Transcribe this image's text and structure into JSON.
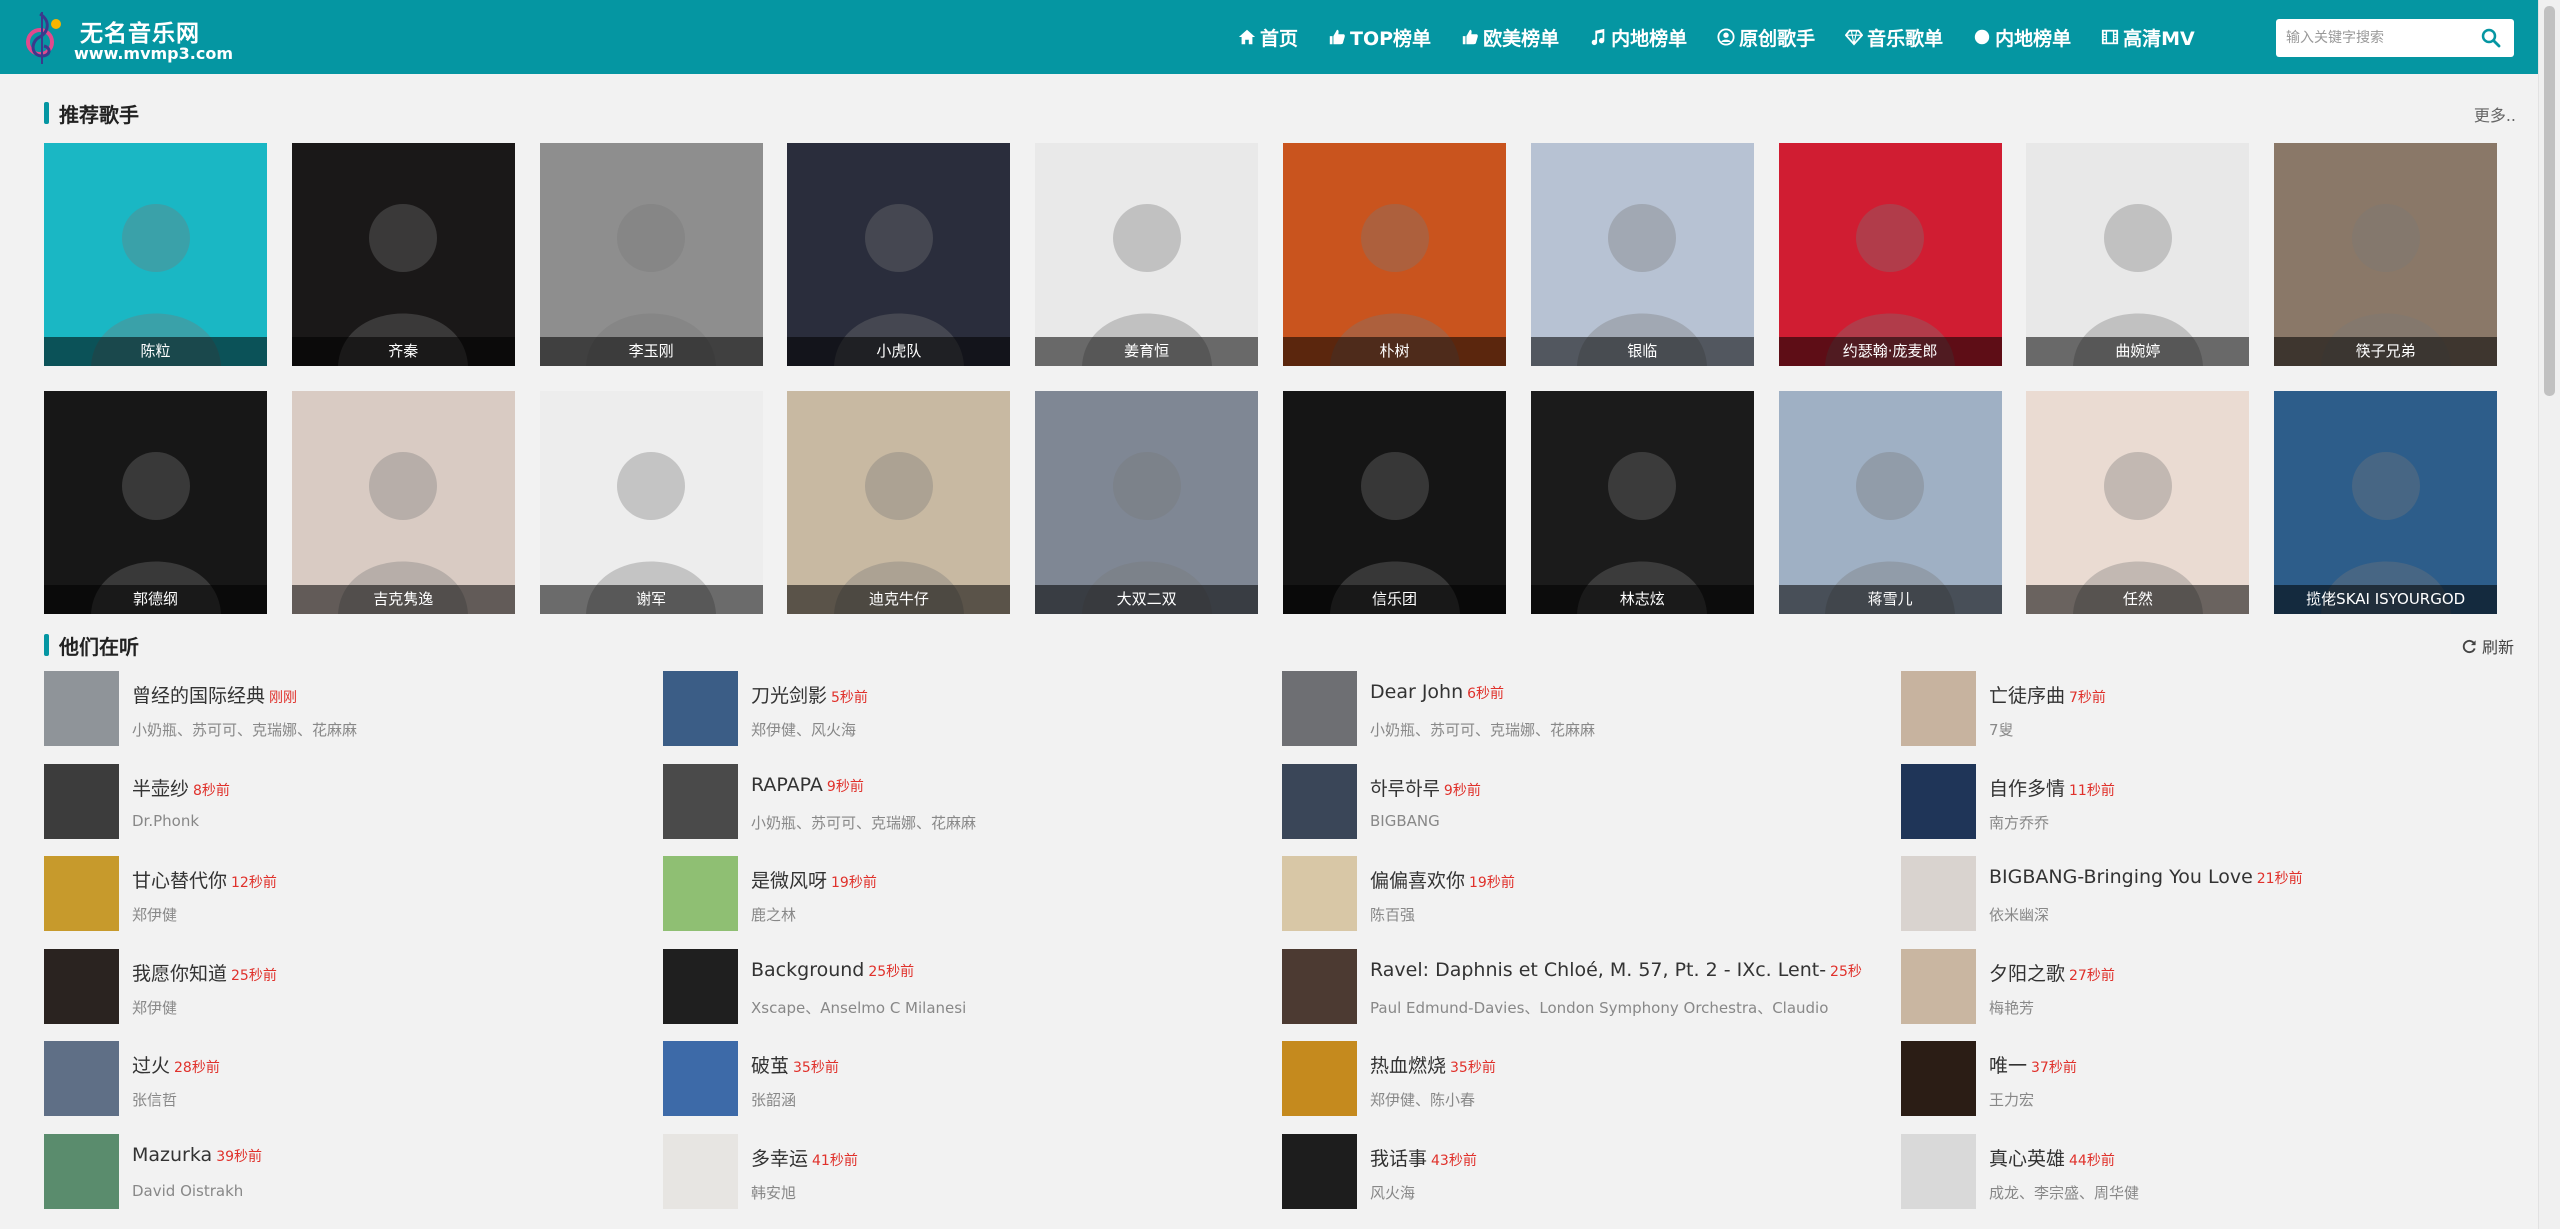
{
  "site": {
    "title": "无名音乐网",
    "url": "www.mvmp3.com",
    "brand_color": "#0596a2",
    "time_color": "#e0312b"
  },
  "nav": [
    {
      "label": "首页",
      "icon": "home-icon"
    },
    {
      "label": "TOP榜单",
      "icon": "thumbs-up-icon"
    },
    {
      "label": "欧美榜单",
      "icon": "thumbs-up-icon"
    },
    {
      "label": "内地榜单",
      "icon": "music-note-icon"
    },
    {
      "label": "原创歌手",
      "icon": "user-circle-icon"
    },
    {
      "label": "音乐歌单",
      "icon": "diamond-icon"
    },
    {
      "label": "内地榜单",
      "icon": "circle-icon"
    },
    {
      "label": "高清MV",
      "icon": "film-icon"
    }
  ],
  "search": {
    "placeholder": "输入关键字搜索",
    "icon": "search-icon"
  },
  "singers_section": {
    "title": "推荐歌手",
    "more": "更多.."
  },
  "singers": [
    {
      "name": "陈粒",
      "color": "#1ab7c4"
    },
    {
      "name": "齐秦",
      "color": "#1a1818"
    },
    {
      "name": "李玉刚",
      "color": "#8e8e8e"
    },
    {
      "name": "小虎队",
      "color": "#2a2d3c"
    },
    {
      "name": "姜育恒",
      "color": "#e9e9e9"
    },
    {
      "name": "朴树",
      "color": "#c9541e"
    },
    {
      "name": "银临",
      "color": "#b7c2d3"
    },
    {
      "name": "约瑟翰·庞麦郎",
      "color": "#d01d32"
    },
    {
      "name": "曲婉婷",
      "color": "#e8e8e8"
    },
    {
      "name": "筷子兄弟",
      "color": "#8a7868"
    },
    {
      "name": "郭德纲",
      "color": "#171717"
    },
    {
      "name": "吉克隽逸",
      "color": "#d9cbc3"
    },
    {
      "name": "谢军",
      "color": "#ededed"
    },
    {
      "name": "迪克牛仔",
      "color": "#c8b9a2"
    },
    {
      "name": "大双二双",
      "color": "#7f8794"
    },
    {
      "name": "信乐团",
      "color": "#151515"
    },
    {
      "name": "林志炫",
      "color": "#1b1b1b"
    },
    {
      "name": "蒋雪儿",
      "color": "#9fb0c4"
    },
    {
      "name": "任然",
      "color": "#eadbd2"
    },
    {
      "name": "揽佬SKAI ISYOURGOD",
      "color": "#2d5d8a"
    }
  ],
  "listening_section": {
    "title": "他们在听",
    "refresh": "刷新"
  },
  "listening": [
    {
      "song": "曾经的国际经典",
      "time": "刚刚",
      "artist": "小奶瓶、苏可可、克瑞娜、花麻麻",
      "color": "#8f9499"
    },
    {
      "song": "刀光剑影",
      "time": "5秒前",
      "artist": "郑伊健、风火海",
      "color": "#3b5d86"
    },
    {
      "song": "Dear John",
      "time": "6秒前",
      "artist": "小奶瓶、苏可可、克瑞娜、花麻麻",
      "color": "#6e6f73"
    },
    {
      "song": "亡徒序曲",
      "time": "7秒前",
      "artist": "7叟",
      "color": "#c7b39f"
    },
    {
      "song": "半壶纱",
      "time": "8秒前",
      "artist": "Dr.Phonk",
      "color": "#3c3c3c"
    },
    {
      "song": "RAPAPA",
      "time": "9秒前",
      "artist": "小奶瓶、苏可可、克瑞娜、花麻麻",
      "color": "#4a4a4a"
    },
    {
      "song": "하루하루",
      "time": "9秒前",
      "artist": "BIGBANG",
      "color": "#3a4658"
    },
    {
      "song": "自作多情",
      "time": "11秒前",
      "artist": "南方乔乔",
      "color": "#1f3558"
    },
    {
      "song": "甘心替代你",
      "time": "12秒前",
      "artist": "郑伊健",
      "color": "#c79a2c"
    },
    {
      "song": "是微风呀",
      "time": "19秒前",
      "artist": "鹿之林",
      "color": "#8fbf73"
    },
    {
      "song": "偏偏喜欢你",
      "time": "19秒前",
      "artist": "陈百强",
      "color": "#d8c7a6"
    },
    {
      "song": "BIGBANG-Bringing You Love",
      "time": "21秒前",
      "artist": "依米幽深",
      "color": "#d9d3cf"
    },
    {
      "song": "我愿你知道",
      "time": "25秒前",
      "artist": "郑伊健",
      "color": "#2a2320"
    },
    {
      "song": "Background",
      "time": "25秒前",
      "artist": "Xscape、Anselmo C Milanesi",
      "color": "#1f1f1f"
    },
    {
      "song": "Ravel: Daphnis et Chloé, M. 57, Pt. 2 - IXc. Lent-",
      "time": "25秒",
      "artist": "Paul Edmund-Davies、London Symphony Orchestra、Claudio",
      "color": "#4c3a32"
    },
    {
      "song": "夕阳之歌",
      "time": "27秒前",
      "artist": "梅艳芳",
      "color": "#c9b6a1"
    },
    {
      "song": "过火",
      "time": "28秒前",
      "artist": "张信哲",
      "color": "#5f6f86"
    },
    {
      "song": "破茧",
      "time": "35秒前",
      "artist": "张韶涵",
      "color": "#3d6aa8"
    },
    {
      "song": "热血燃烧",
      "time": "35秒前",
      "artist": "郑伊健、陈小春",
      "color": "#c58a1e"
    },
    {
      "song": "唯一",
      "time": "37秒前",
      "artist": "王力宏",
      "color": "#2b1d15"
    },
    {
      "song": "Mazurka",
      "time": "39秒前",
      "artist": "David Oistrakh",
      "color": "#5a8c6d"
    },
    {
      "song": "多幸运",
      "time": "41秒前",
      "artist": "韩安旭",
      "color": "#e7e5e2"
    },
    {
      "song": "我话事",
      "time": "43秒前",
      "artist": "风火海",
      "color": "#1d1d1d"
    },
    {
      "song": "真心英雄",
      "time": "44秒前",
      "artist": "成龙、李宗盛、周华健",
      "color": "#d9d9d9"
    }
  ]
}
